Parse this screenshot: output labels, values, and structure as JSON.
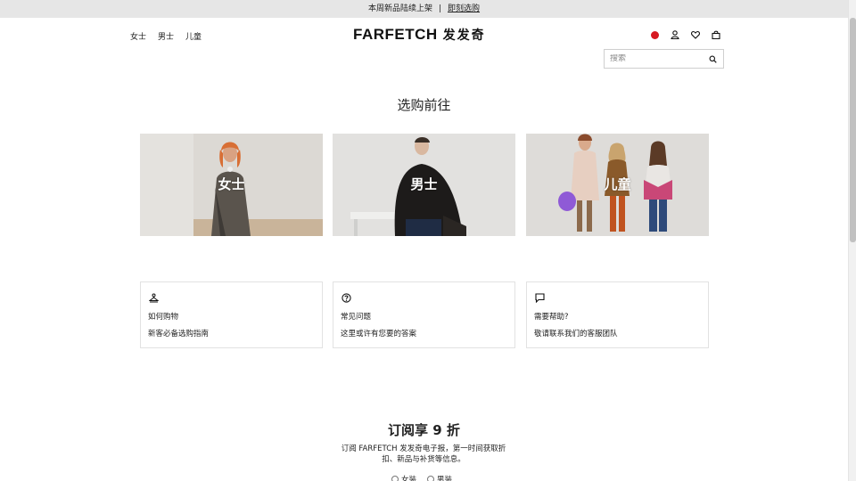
{
  "banner": {
    "text": "本周新品陆续上架",
    "separator": "|",
    "link": "即刻选购"
  },
  "nav": {
    "women": "女士",
    "men": "男士",
    "kids": "儿童"
  },
  "logo": {
    "brand": "FARFETCH",
    "cn": "发发奇"
  },
  "header_icons": [
    "flag-icon",
    "account-icon",
    "wishlist-heart-icon",
    "shopping-bag-icon"
  ],
  "search": {
    "placeholder": "搜索"
  },
  "shop": {
    "heading": "选购前往",
    "tiles": [
      {
        "label": "女士"
      },
      {
        "label": "男士"
      },
      {
        "label": "儿童"
      }
    ]
  },
  "help_cards": [
    {
      "icon": "hanger-icon",
      "title": "如何购物",
      "desc": "新客必备选购指南"
    },
    {
      "icon": "question-circle-icon",
      "title": "常见问题",
      "desc": "这里或许有您要的答案"
    },
    {
      "icon": "chat-bubble-icon",
      "title": "需要帮助?",
      "desc": "敬请联系我们的客服团队"
    }
  ],
  "subscribe": {
    "title": "订阅享 9 折",
    "desc": "订阅 FARFETCH 发发奇电子报，第一时间获取折扣、新品与补货等信息。",
    "options": [
      "女装",
      "男装"
    ]
  },
  "colors": {
    "banner_bg": "#e6e6e6",
    "flag_red": "#d71921",
    "border": "#e2e2e2"
  }
}
